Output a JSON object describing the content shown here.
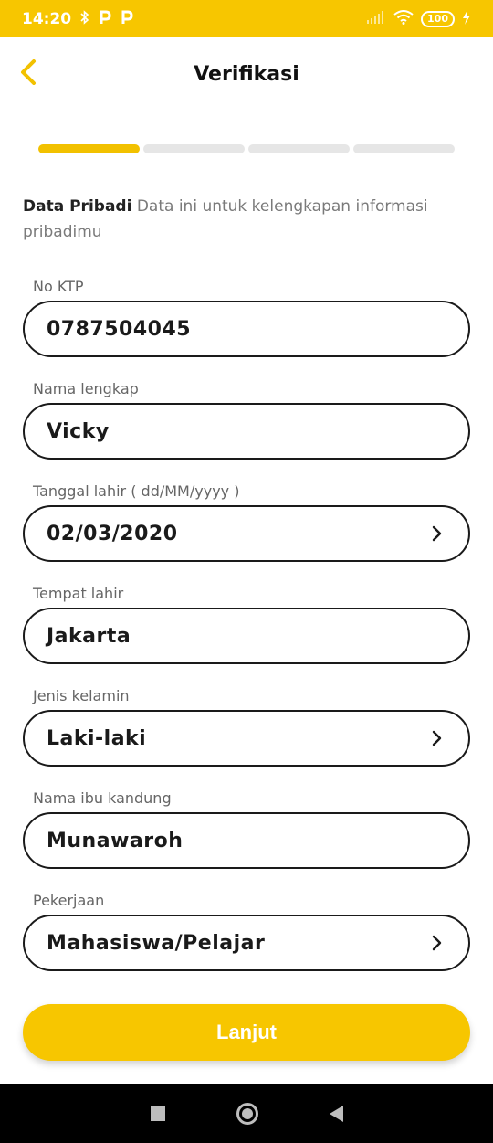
{
  "status_bar": {
    "time": "14:20",
    "left_icons": [
      "bluetooth-icon",
      "p-icon",
      "p-icon"
    ],
    "battery": "100"
  },
  "header": {
    "back_icon": "chevron-left-icon",
    "title": "Verifikasi"
  },
  "progress": {
    "total_steps": 4,
    "current_step": 1
  },
  "intro": {
    "heading": "Data Pribadi",
    "text": "Data ini untuk kelengkapan informasi pribadimu"
  },
  "form": {
    "fields": [
      {
        "label": "No KTP",
        "value": "0787504045",
        "has_chevron": false
      },
      {
        "label": "Nama lengkap",
        "value": "Vicky",
        "has_chevron": false
      },
      {
        "label": "Tanggal lahir ( dd/MM/yyyy )",
        "value": "02/03/2020",
        "has_chevron": true
      },
      {
        "label": "Tempat lahir",
        "value": "Jakarta",
        "has_chevron": false
      },
      {
        "label": "Jenis kelamin",
        "value": "Laki-laki",
        "has_chevron": true
      },
      {
        "label": "Nama ibu kandung",
        "value": "Munawaroh",
        "has_chevron": false
      },
      {
        "label": "Pekerjaan",
        "value": "Mahasiswa/Pelajar",
        "has_chevron": true
      }
    ]
  },
  "cta": {
    "label": "Lanjut"
  },
  "colors": {
    "accent": "#F7C600",
    "border": "#1a1a1a",
    "progress_inactive": "#e6e6e6"
  }
}
